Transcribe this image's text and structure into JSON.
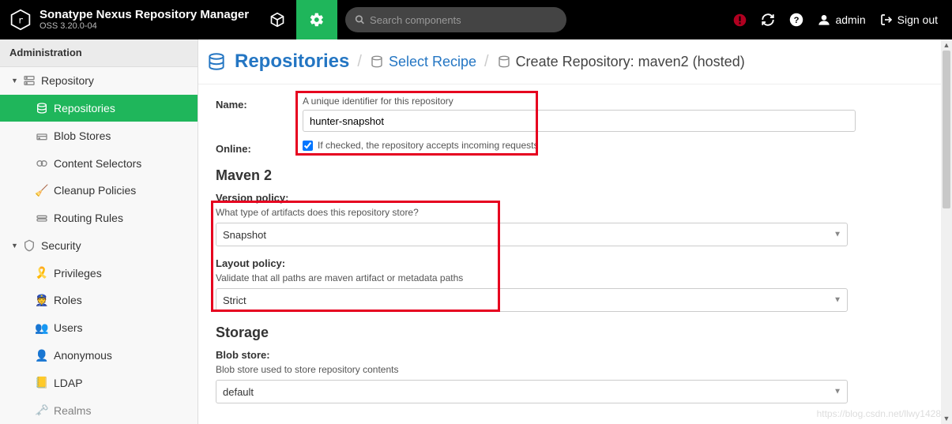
{
  "header": {
    "product_title": "Sonatype Nexus Repository Manager",
    "product_sub": "OSS 3.20.0-04",
    "search_placeholder": "Search components",
    "user_label": "admin",
    "signout_label": "Sign out"
  },
  "sidebar": {
    "title": "Administration",
    "groups": [
      {
        "label": "Repository",
        "icon": "server-icon",
        "children": [
          {
            "label": "Repositories",
            "icon": "disks-icon",
            "active": true
          },
          {
            "label": "Blob Stores",
            "icon": "disk-icon"
          },
          {
            "label": "Content Selectors",
            "icon": "tags-icon"
          },
          {
            "label": "Cleanup Policies",
            "icon": "broom-icon"
          },
          {
            "label": "Routing Rules",
            "icon": "route-icon"
          }
        ]
      },
      {
        "label": "Security",
        "icon": "shield-icon",
        "children": [
          {
            "label": "Privileges",
            "icon": "ribbon-icon"
          },
          {
            "label": "Roles",
            "icon": "badge-icon"
          },
          {
            "label": "Users",
            "icon": "users-icon"
          },
          {
            "label": "Anonymous",
            "icon": "anon-icon"
          },
          {
            "label": "LDAP",
            "icon": "book-icon"
          },
          {
            "label": "Realms",
            "icon": "realms-icon"
          }
        ]
      }
    ]
  },
  "breadcrumb": {
    "main": "Repositories",
    "step2": "Select Recipe",
    "step3": "Create Repository: maven2 (hosted)"
  },
  "form": {
    "name_label": "Name:",
    "name_help": "A unique identifier for this repository",
    "name_value": "hunter-snapshot",
    "online_label": "Online:",
    "online_checked": true,
    "online_help": "If checked, the repository accepts incoming requests",
    "maven_section": "Maven 2",
    "version_policy_label": "Version policy:",
    "version_policy_help": "What type of artifacts does this repository store?",
    "version_policy_value": "Snapshot",
    "layout_policy_label": "Layout policy:",
    "layout_policy_help": "Validate that all paths are maven artifact or metadata paths",
    "layout_policy_value": "Strict",
    "storage_section": "Storage",
    "blob_store_label": "Blob store:",
    "blob_store_help": "Blob store used to store repository contents",
    "blob_store_value": "default"
  },
  "watermark": "https://blog.csdn.net/llwy1428"
}
